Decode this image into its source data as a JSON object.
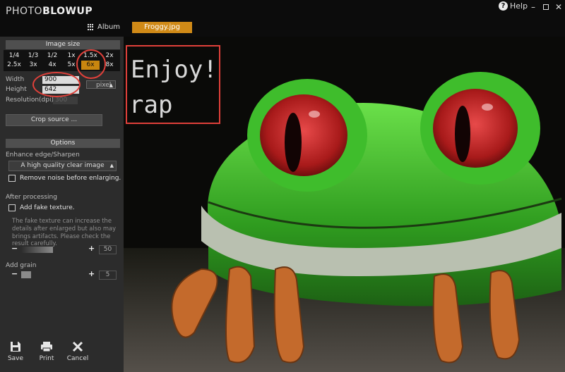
{
  "app": {
    "title_part1": "PHOTO",
    "title_part2": "BLOWUP"
  },
  "window": {
    "help_label": "Help"
  },
  "tabs": {
    "album_label": "Album",
    "file_label": "Froggy.jpg"
  },
  "image_size": {
    "header": "Image size",
    "zoom_row1": [
      "1/4",
      "1/3",
      "1/2",
      "1x",
      "1.5x",
      "2x"
    ],
    "zoom_row2": [
      "2.5x",
      "3x",
      "4x",
      "5x",
      "6x",
      "8x"
    ],
    "selected": "6x",
    "width_label": "Width",
    "width_value": "900",
    "height_label": "Height",
    "height_value": "642",
    "unit": "pixel",
    "resolution_label": "Resolution(dpi)",
    "resolution_value": "300",
    "crop_button": "Crop source ..."
  },
  "options": {
    "header": "Options",
    "enhance_label": "Enhance edge/Sharpen",
    "enhance_value": "A high quality clear image",
    "remove_noise_label": "Remove noise before enlarging.",
    "after_processing_label": "After processing",
    "fake_texture_label": "Add fake texture.",
    "fake_texture_desc": "The fake texture can increase the details after enlarged but also may brings artifacts. Please check the result carefully.",
    "texture_value": "50",
    "add_grain_label": "Add grain",
    "grain_value": "5",
    "minus": "−",
    "plus": "+"
  },
  "toolbar": {
    "save_label": "Save",
    "print_label": "Print",
    "cancel_label": "Cancel"
  },
  "image": {
    "overlay_text_line1": "Enjoy!",
    "overlay_text_line2": "rap"
  },
  "colors": {
    "accent": "#c9860f",
    "annotation": "#e0403a",
    "panel": "#2c2c2c"
  }
}
